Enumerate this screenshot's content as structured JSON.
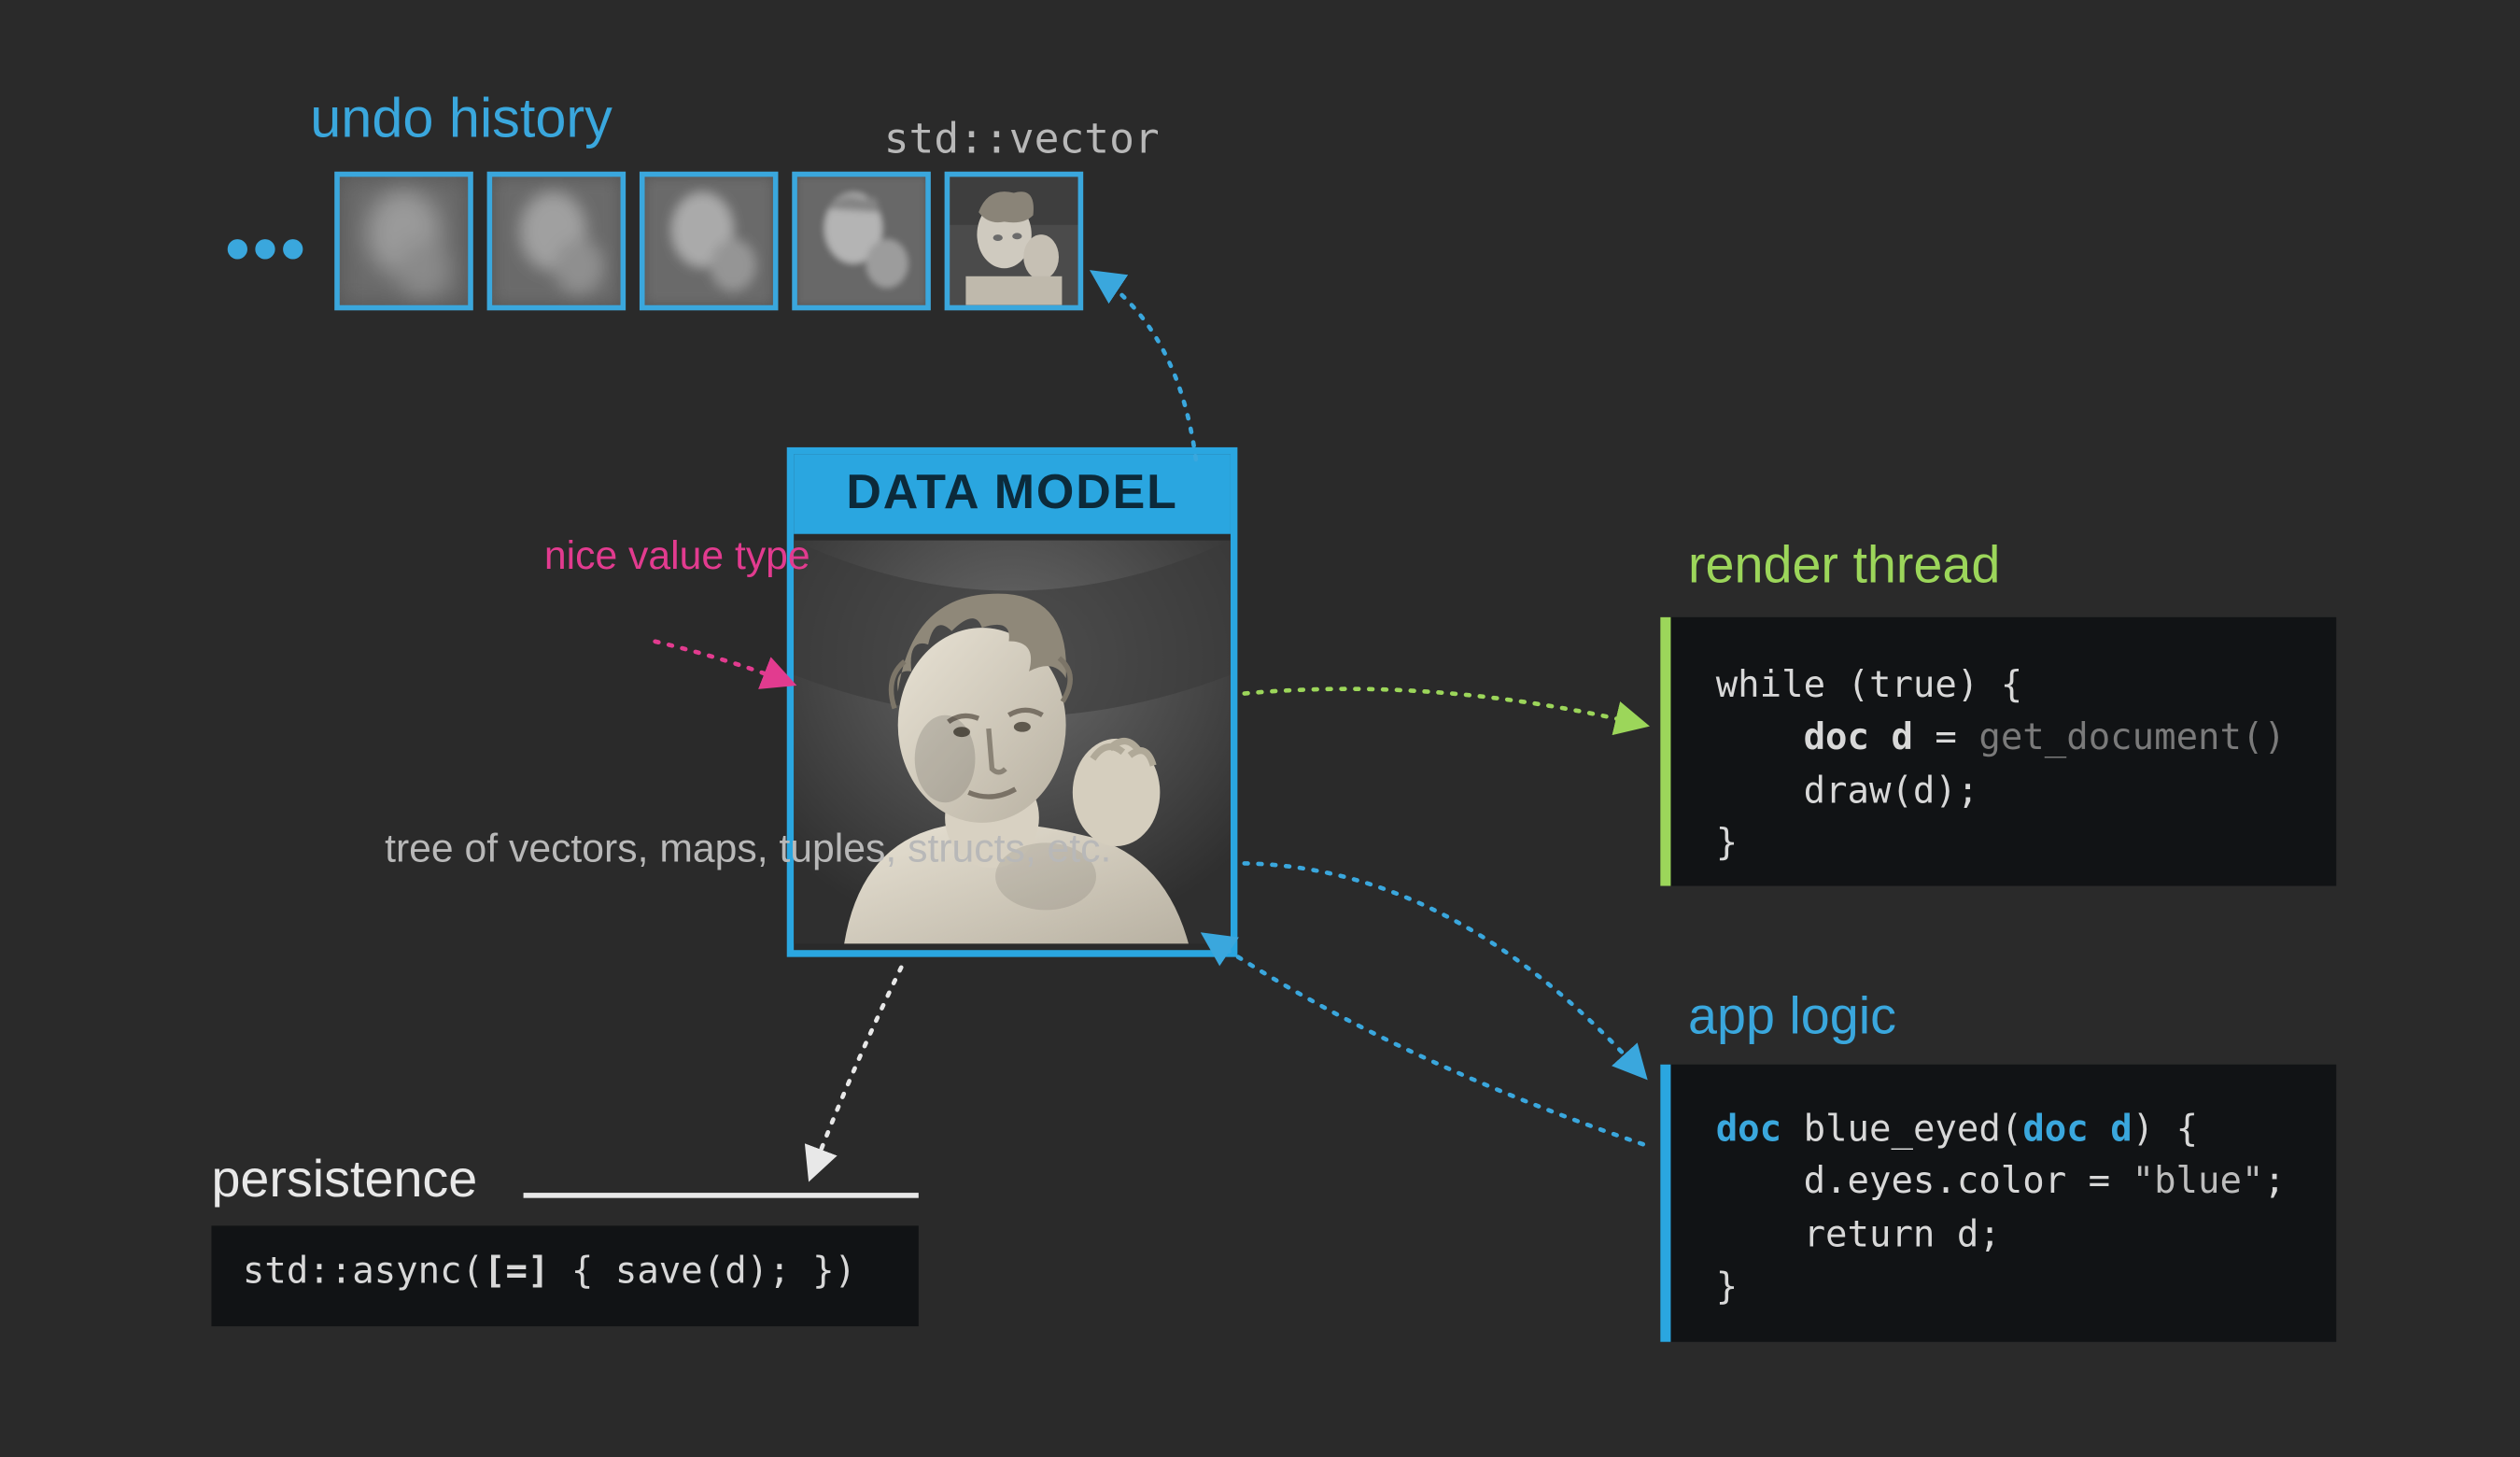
{
  "undo": {
    "title": "undo history",
    "ellipsis": "•••",
    "vector_label": "std::vector"
  },
  "model": {
    "header": "DATA MODEL",
    "nice_value_type": "nice\nvalue\ntype",
    "tree_desc": "tree of\nvectors, maps,\ntuples, structs, etc."
  },
  "render": {
    "title": "render thread",
    "code": {
      "l1_a": "while (true) {",
      "l2_kw": "doc d",
      "l2_b": " = ",
      "l2_dim": "get_document()",
      "l3": "    draw(d);",
      "l4": "}"
    }
  },
  "app": {
    "title": "app logic",
    "code": {
      "kw_doc": "doc",
      "fn": "blue_eyed",
      "param_kw": "doc d",
      "l2": "    d.eyes.color = ",
      "str": "\"blue\"",
      "semi": ";",
      "l3": "    return d;",
      "l4": "}"
    }
  },
  "persist": {
    "title": "persistence",
    "code": {
      "a": "std::async(",
      "kw": "[=]",
      "b": " { save(d); })"
    }
  }
}
